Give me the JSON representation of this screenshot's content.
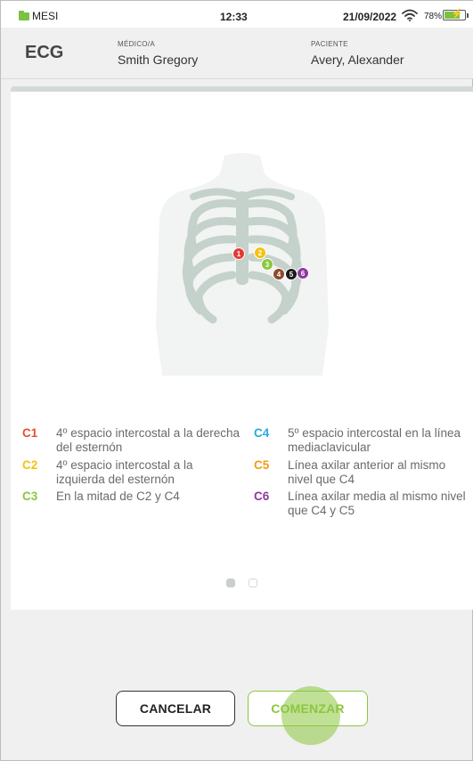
{
  "status_bar": {
    "app_name": "MESI",
    "time": "12:33",
    "date": "21/09/2022",
    "battery_percent": "78%",
    "battery_level": 0.78,
    "wifi_icon": "wifi-icon",
    "battery_icon": "battery-charging-icon"
  },
  "header": {
    "title": "ECG",
    "doctor_label": "MÉDICO/A",
    "doctor_name": "Smith Gregory",
    "patient_label": "PACIENTE",
    "patient_name": "Avery, Alexander"
  },
  "electrodes": [
    {
      "num": "1",
      "color": "#e53935"
    },
    {
      "num": "2",
      "color": "#f4c20d"
    },
    {
      "num": "3",
      "color": "#8cc63f"
    },
    {
      "num": "4",
      "color": "#8d4a2b"
    },
    {
      "num": "5",
      "color": "#1a1a1a"
    },
    {
      "num": "6",
      "color": "#8e3a9e"
    }
  ],
  "legend": [
    {
      "code": "C1",
      "color": "#e8502d",
      "text": "4º espacio intercostal a la derecha del esternón"
    },
    {
      "code": "C2",
      "color": "#f4c20d",
      "text": "4º espacio intercostal a la izquierda del esternón"
    },
    {
      "code": "C3",
      "color": "#8cc63f",
      "text": "En la mitad de C2 y C4"
    },
    {
      "code": "C4",
      "color": "#29a8e0",
      "text": "5º espacio intercostal en la línea mediaclavicular"
    },
    {
      "code": "C5",
      "color": "#f39c12",
      "text": "Línea axilar anterior al mismo nivel que C4"
    },
    {
      "code": "C6",
      "color": "#8e3a9e",
      "text": "Línea axilar media al mismo nivel que C4 y C5"
    }
  ],
  "pager": {
    "pages": 2,
    "current": 1
  },
  "buttons": {
    "cancel": "CANCELAR",
    "start": "COMENZAR"
  }
}
